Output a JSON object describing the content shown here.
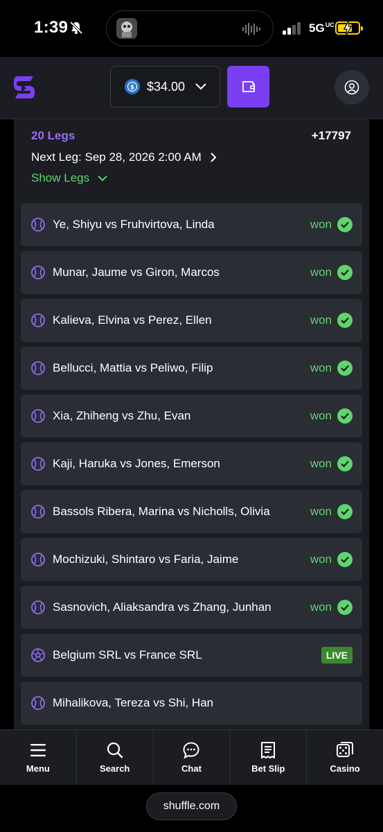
{
  "status_bar": {
    "time": "1:39",
    "network": "5G",
    "network_sub": "UC",
    "battery_color": "#ffd60a"
  },
  "header": {
    "balance": "$34.00",
    "accent_color": "#7b3ff2"
  },
  "bet": {
    "legs_count": "20 Legs",
    "odds": "+17797",
    "next_leg": "Next Leg: Sep 28, 2026 2:00 AM",
    "show_legs": "Show Legs",
    "legs": [
      {
        "match": "Ye, Shiyu vs Fruhvirtova, Linda",
        "status": "won",
        "sport_icon": "tennis-ball-icon"
      },
      {
        "match": "Munar, Jaume vs Giron, Marcos",
        "status": "won",
        "sport_icon": "tennis-ball-icon"
      },
      {
        "match": "Kalieva, Elvina vs Perez, Ellen",
        "status": "won",
        "sport_icon": "tennis-ball-icon"
      },
      {
        "match": "Bellucci, Mattia vs Peliwo, Filip",
        "status": "won",
        "sport_icon": "tennis-ball-icon"
      },
      {
        "match": "Xia, Zhiheng vs Zhu, Evan",
        "status": "won",
        "sport_icon": "tennis-ball-icon"
      },
      {
        "match": "Kaji, Haruka vs Jones, Emerson",
        "status": "won",
        "sport_icon": "tennis-ball-icon"
      },
      {
        "match": "Bassols Ribera, Marina vs Nicholls, Olivia",
        "status": "won",
        "sport_icon": "tennis-ball-icon"
      },
      {
        "match": "Mochizuki, Shintaro vs Faria, Jaime",
        "status": "won",
        "sport_icon": "tennis-ball-icon"
      },
      {
        "match": "Sasnovich, Aliaksandra vs Zhang, Junhan",
        "status": "won",
        "sport_icon": "tennis-ball-icon"
      },
      {
        "match": "Belgium SRL vs France SRL",
        "status": "LIVE",
        "sport_icon": "soccer-ball-icon"
      },
      {
        "match": "Mihalikova, Tereza vs Shi, Han",
        "status": "",
        "sport_icon": "tennis-ball-icon"
      }
    ]
  },
  "bottom_nav": {
    "menu": "Menu",
    "search": "Search",
    "chat": "Chat",
    "bet_slip": "Bet Slip",
    "casino": "Casino"
  },
  "browser": {
    "url": "shuffle.com"
  }
}
